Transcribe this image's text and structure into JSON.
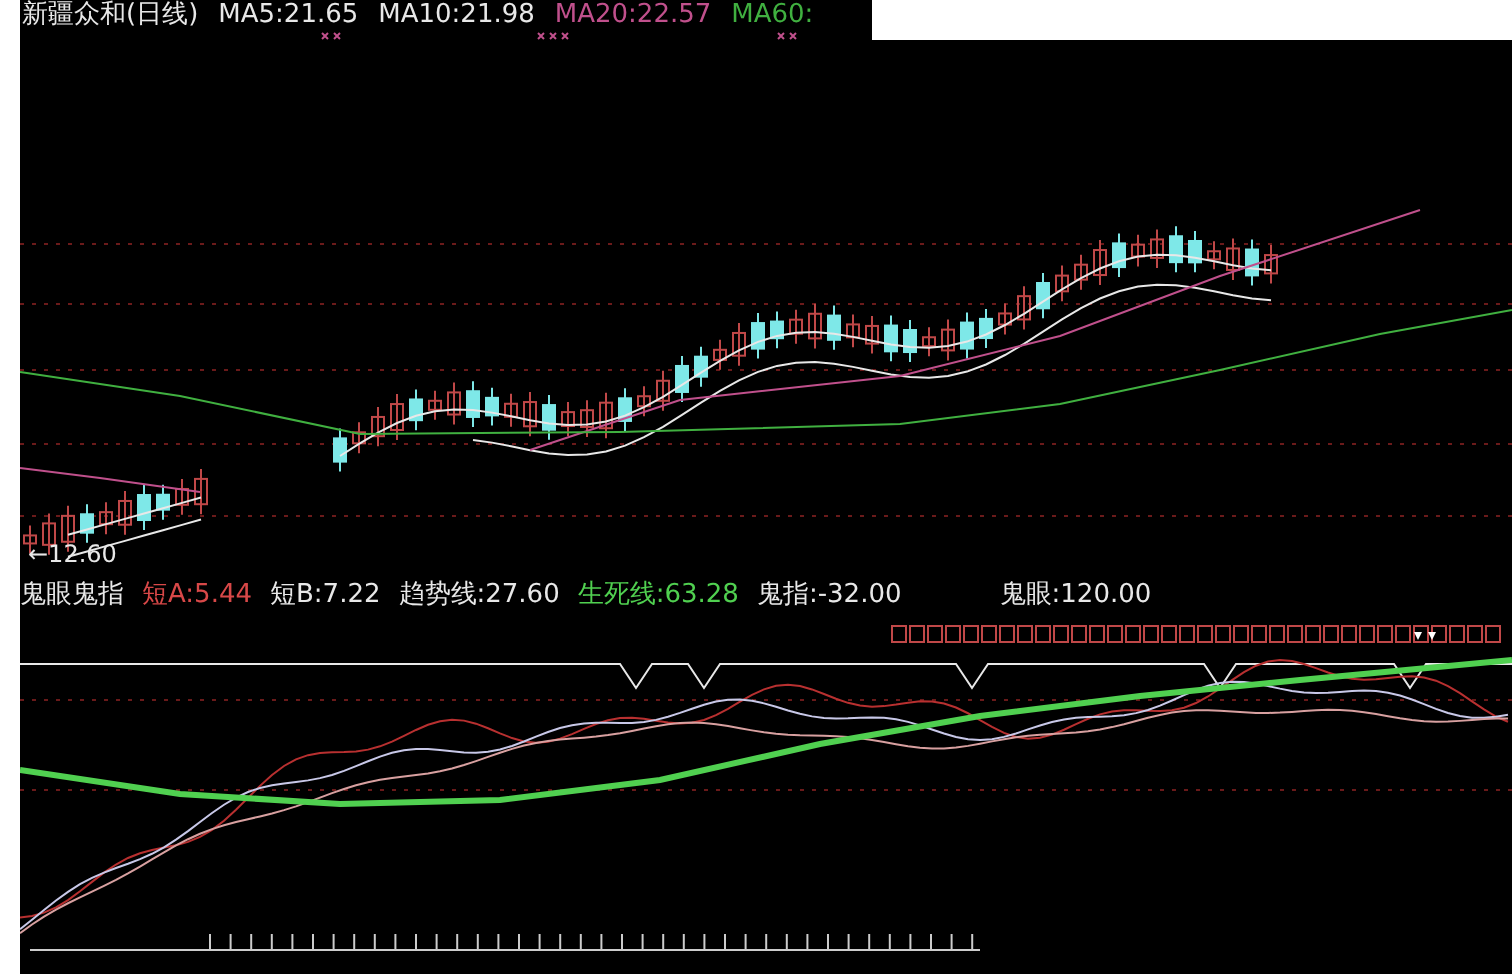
{
  "header": {
    "title": "新疆众和(日线)",
    "indicators": [
      {
        "label": "MA5:21.65",
        "color": "#e8e8e8"
      },
      {
        "label": "MA10:21.98",
        "color": "#e8e8e8"
      },
      {
        "label": "MA20:22.57",
        "color": "#c0508c"
      },
      {
        "label": "MA60:",
        "color": "#40b040"
      }
    ]
  },
  "price_chart": {
    "low_marker": "←12.60"
  },
  "indicator_panel": {
    "title": "鬼眼鬼指",
    "values": [
      {
        "label": "短A:5.44",
        "color": "#d84848"
      },
      {
        "label": "短B:7.22",
        "color": "#e8e8e8"
      },
      {
        "label": "趋势线:27.60",
        "color": "#e8e8e8"
      },
      {
        "label": "生死线:63.28",
        "color": "#50d050"
      },
      {
        "label": "鬼指:-32.00",
        "color": "#e8e8e8"
      },
      {
        "label": "鬼眼:120.00",
        "color": "#e8e8e8"
      }
    ]
  }
}
